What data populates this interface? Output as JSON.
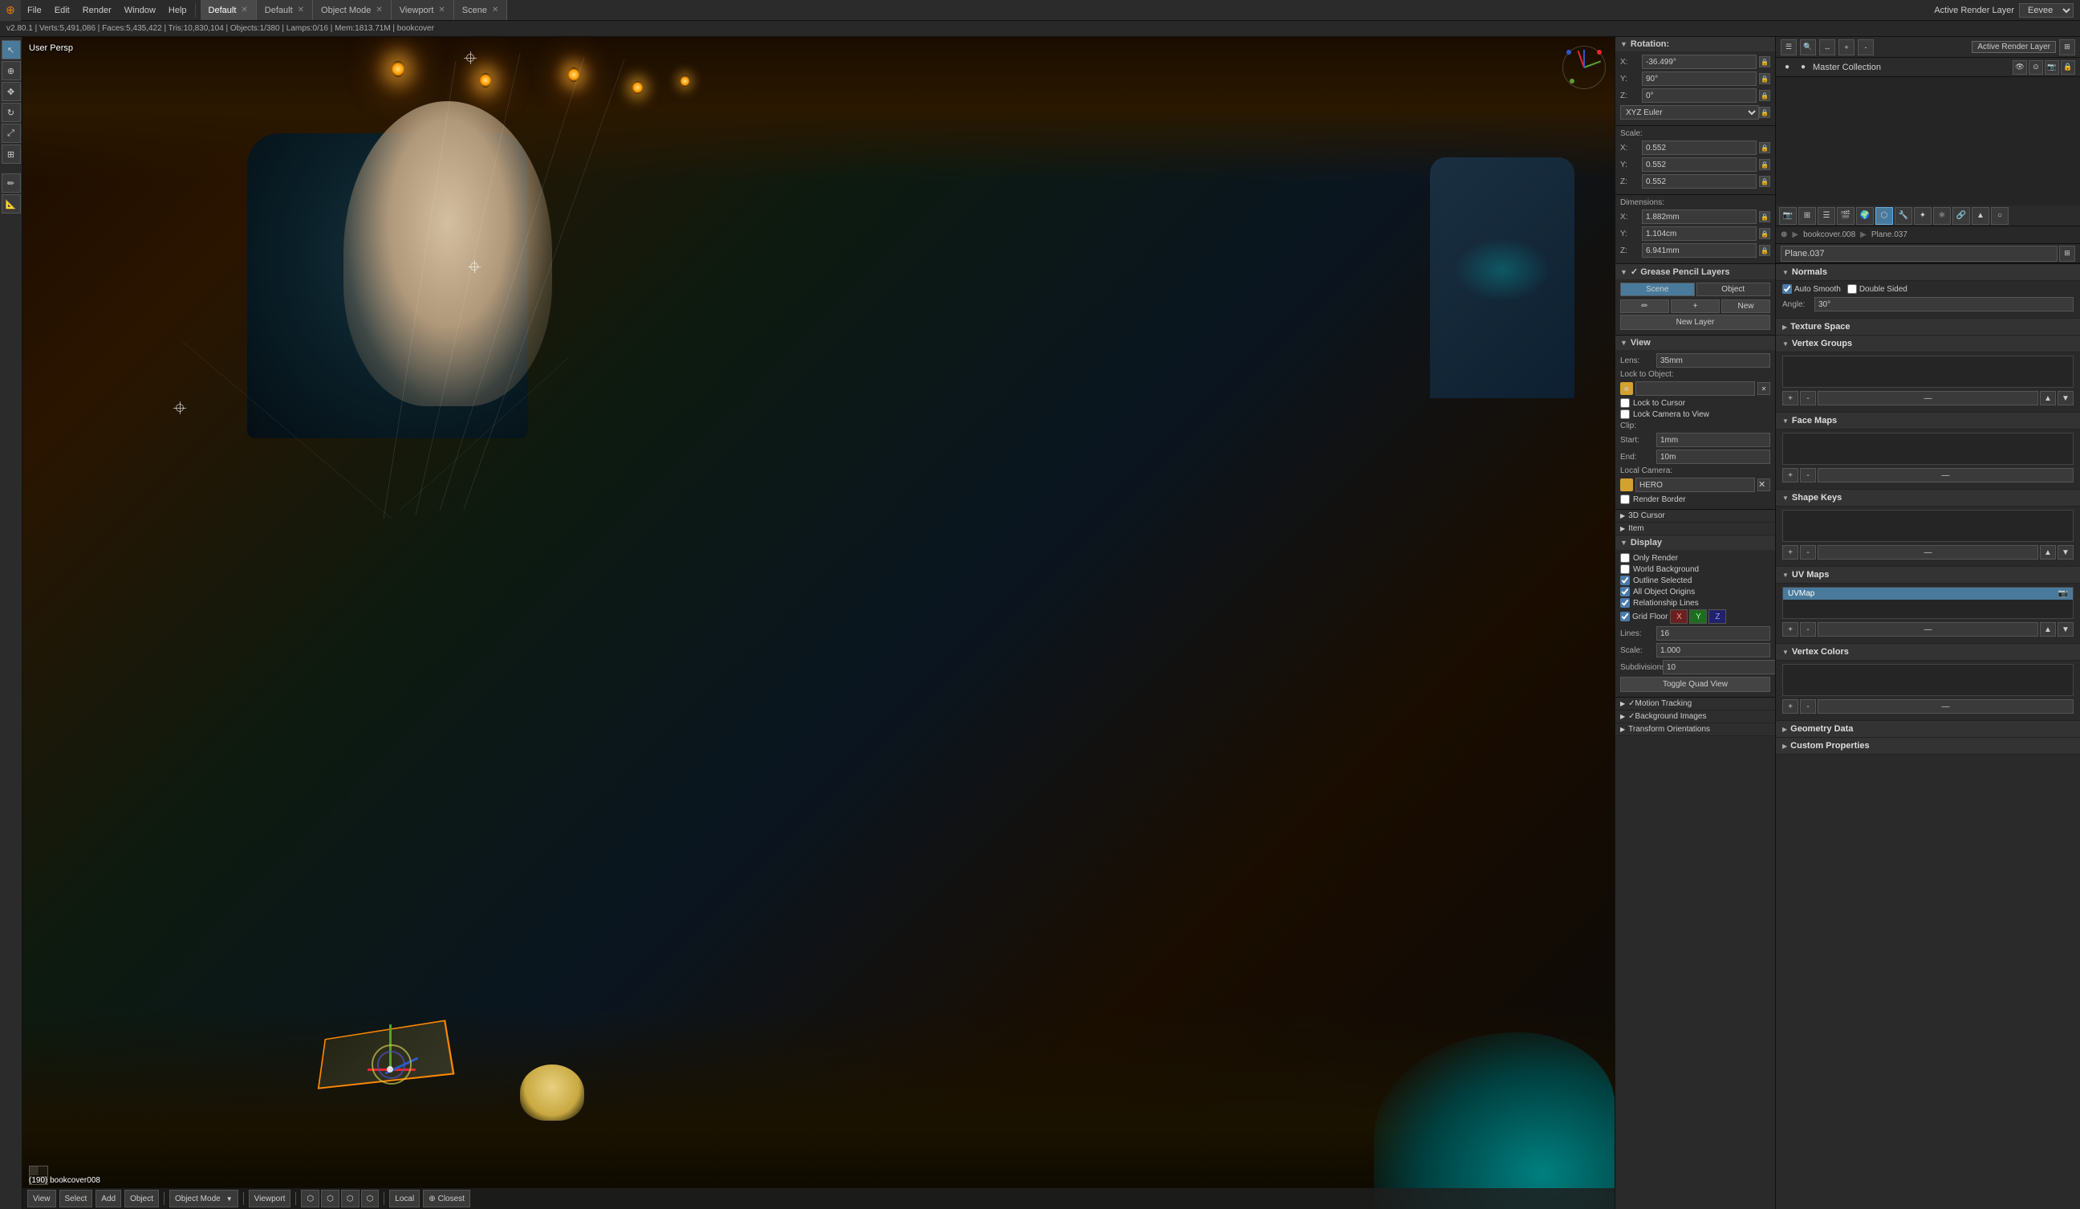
{
  "app": {
    "title": "Blender",
    "version": "v2.80.1",
    "engine": "Eevee"
  },
  "top_bar": {
    "menus": [
      "File",
      "Edit",
      "Render",
      "Window",
      "Help"
    ],
    "workspaces": [
      {
        "label": "Default",
        "active": true
      },
      {
        "label": "Default",
        "active": false
      },
      {
        "label": "Object Mode",
        "active": false
      },
      {
        "label": "Viewport",
        "active": false
      },
      {
        "label": "Scene",
        "active": false
      }
    ],
    "active_render_layer": "Active Render Layer"
  },
  "info_bar": {
    "stats": "v2.80.1 | Verts:5,491,086 | Faces:5,435,422 | Tris:10,830,104 | Objects:1/380 | Lamps:0/16 | Mem:1813.71M | bookcover"
  },
  "viewport": {
    "mode": "User Persp",
    "bottom_info": "(190) bookcover008"
  },
  "n_panel": {
    "rotation": {
      "label": "Rotation:",
      "x": "-36.499°",
      "y": "90°",
      "z": "0°"
    },
    "rotation_mode": "XYZ Euler",
    "scale": {
      "label": "Scale:",
      "x": "0.552",
      "y": "0.552",
      "z": "0.552"
    },
    "dimensions": {
      "label": "Dimensions:",
      "x": "1.882mm",
      "y": "1.104cm",
      "z": "6.941mm"
    },
    "grease_pencil": {
      "tab_scene": "Scene",
      "tab_object": "Object",
      "btn_new": "New",
      "btn_new_layer": "New Layer"
    },
    "view": {
      "label": "View",
      "lens_label": "Lens:",
      "lens_value": "35mm",
      "lock_to_object_label": "Lock to Object:",
      "lock_to_cursor": "Lock to Cursor",
      "lock_camera_to_view": "Lock Camera to View",
      "clip_label": "Clip:",
      "clip_start_label": "Start:",
      "clip_start_value": "1mm",
      "clip_end_label": "End:",
      "clip_end_value": "10m",
      "local_camera_label": "Local Camera:",
      "local_camera_value": "HERO",
      "render_border": "Render Border",
      "btn_3d_cursor": "3D Cursor",
      "btn_item": "Item",
      "btn_display": "Display",
      "only_render": "Only Render",
      "world_background": "World Background",
      "outline_selected": "Outline Selected",
      "all_object_origins": "All Object Origins",
      "relationship_lines": "Relationship Lines",
      "grid_floor": "Grid Floor",
      "x_axis": "X",
      "y_axis": "Y",
      "z_axis": "Z",
      "lines_label": "Lines:",
      "lines_value": "16",
      "scale_label": "Scale:",
      "scale_value": "1.000",
      "subdivisions_label": "Subdivisions:",
      "subdivisions_value": "10",
      "toggle_quad_view": "Toggle Quad View"
    },
    "motion_tracking": "Motion Tracking",
    "background_images": "Background Images",
    "transform_orientations": "Transform Orientations"
  },
  "outliner": {
    "title": "Master Collection",
    "active_render_layer": "Active Render Layer"
  },
  "properties": {
    "object_path": "bookcover.008",
    "object_name": "Plane.037",
    "sections": {
      "normals": {
        "label": "Normals",
        "auto_smooth": "Auto Smooth",
        "double_sided": "Double Sided",
        "angle_label": "Angle:",
        "angle_value": "30°"
      },
      "texture_space": "Texture Space",
      "vertex_groups": "Vertex Groups",
      "face_maps": "Face Maps",
      "shape_keys": "Shape Keys",
      "uv_maps": {
        "label": "UV Maps",
        "selected": "UVMap"
      },
      "vertex_colors": "Vertex Colors",
      "geometry_data": "Geometry Data",
      "custom_properties": "Custom Properties"
    }
  },
  "bottom_bar": {
    "view": "View",
    "select": "Select",
    "add": "Add",
    "object": "Object",
    "mode": "Object Mode",
    "viewport_shading": "Viewport",
    "transform_pivot": "Local",
    "snap": "Closest"
  }
}
